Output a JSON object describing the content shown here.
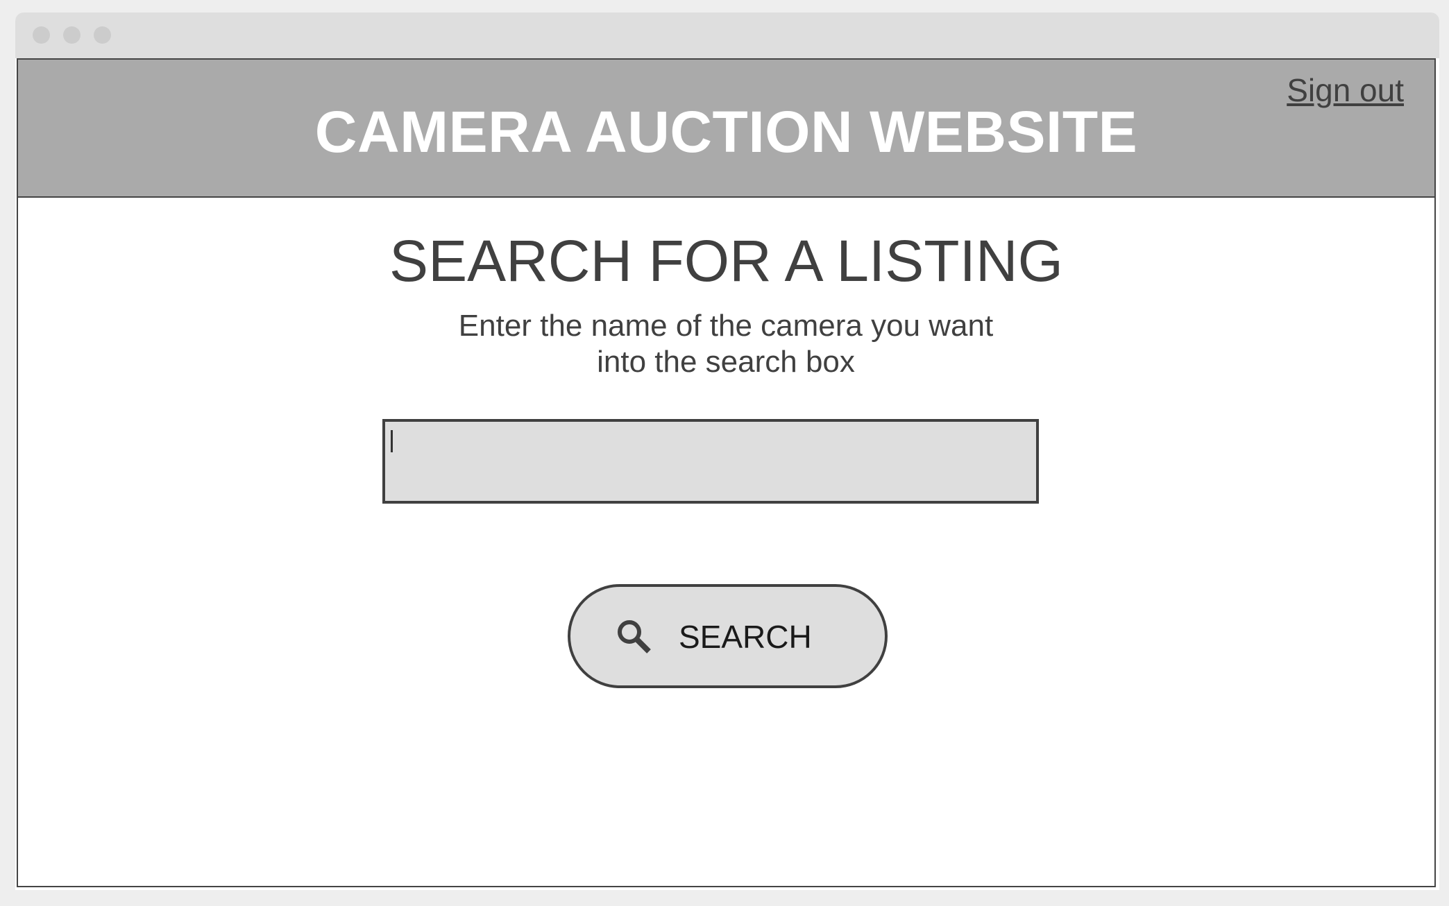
{
  "header": {
    "title": "CAMERA AUCTION WEBSITE",
    "signout_label": "Sign out"
  },
  "main": {
    "heading": "SEARCH FOR A LISTING",
    "subtitle_line1": "Enter the name of the camera you want",
    "subtitle_line2": "into the search box",
    "search_input": {
      "value": "",
      "placeholder": ""
    },
    "search_button": {
      "label": "SEARCH",
      "icon": "search-icon"
    }
  },
  "colors": {
    "header_bg": "#aaaaaa",
    "header_text": "#ffffff",
    "text": "#404040",
    "input_bg": "#dedede",
    "border": "#404040"
  }
}
